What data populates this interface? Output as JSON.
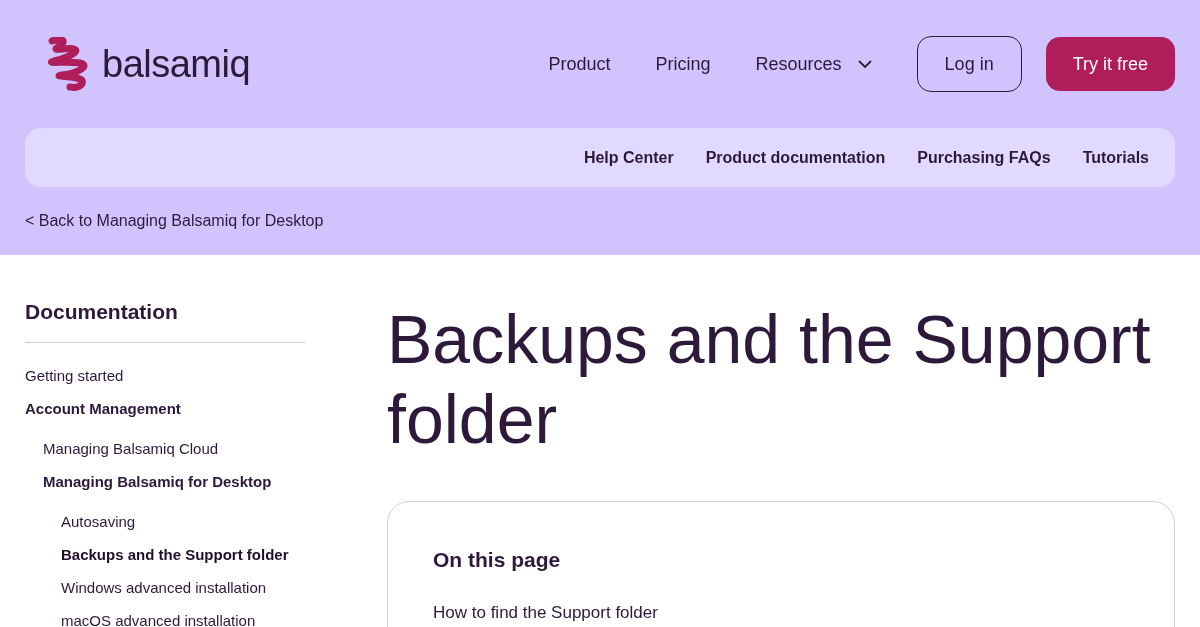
{
  "header": {
    "logo_text": "balsamiq",
    "nav": [
      {
        "label": "Product",
        "kind": "link"
      },
      {
        "label": "Pricing",
        "kind": "link"
      },
      {
        "label": "Resources",
        "kind": "dropdown"
      }
    ],
    "login_button": "Log in",
    "trial_button": "Try it free"
  },
  "subnav": [
    "Help Center",
    "Product documentation",
    "Purchasing FAQs",
    "Tutorials"
  ],
  "back_link": "< Back to Managing Balsamiq for Desktop",
  "sidebar": {
    "title": "Documentation",
    "items": [
      {
        "label": "Getting started",
        "expanded": false,
        "selected": false
      },
      {
        "label": "Account Management",
        "expanded": true,
        "selected": false,
        "children": [
          {
            "label": "Managing Balsamiq Cloud",
            "expanded": false,
            "selected": false
          },
          {
            "label": "Managing Balsamiq for Desktop",
            "expanded": true,
            "selected": false,
            "children": [
              {
                "label": "Autosaving",
                "expanded": false,
                "selected": false
              },
              {
                "label": "Backups and the Support folder",
                "expanded": false,
                "selected": true
              },
              {
                "label": "Windows advanced installation",
                "expanded": false,
                "selected": false
              },
              {
                "label": "macOS advanced installation",
                "expanded": false,
                "selected": false
              }
            ]
          }
        ]
      }
    ]
  },
  "article": {
    "title": "Backups and the Support folder",
    "toc": {
      "title": "On this page",
      "items": [
        "How to find the Support folder"
      ]
    }
  }
}
